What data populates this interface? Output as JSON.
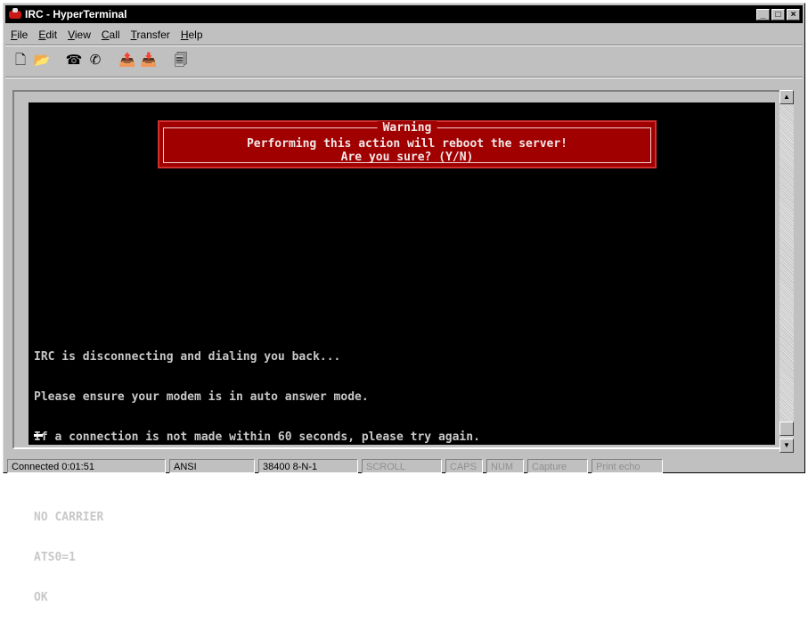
{
  "window": {
    "title": "IRC - HyperTerminal",
    "minimize_glyph": "_",
    "maximize_glyph": "□",
    "close_glyph": "×"
  },
  "menu": {
    "items": [
      {
        "label": "File"
      },
      {
        "label": "Edit"
      },
      {
        "label": "View"
      },
      {
        "label": "Call"
      },
      {
        "label": "Transfer"
      },
      {
        "label": "Help"
      }
    ]
  },
  "toolbar": {
    "buttons": [
      {
        "name": "new-icon",
        "glyph": "🗋"
      },
      {
        "name": "open-icon",
        "glyph": "📂"
      },
      {
        "name": "connect-icon",
        "glyph": "☎"
      },
      {
        "name": "disconnect-icon",
        "glyph": "✆"
      },
      {
        "name": "send-icon",
        "glyph": "📤"
      },
      {
        "name": "receive-icon",
        "glyph": "📥"
      },
      {
        "name": "properties-icon",
        "glyph": "🗐"
      }
    ]
  },
  "terminal": {
    "warning_title": "Warning",
    "warning_line1": "Performing this action will reboot the server!",
    "warning_line2": "Are you sure? (Y/N)",
    "lines": [
      "IRC is disconnecting and dialing you back...",
      "Please ensure your modem is in auto answer mode.",
      "If a connection is not made within 60 seconds, please try again.",
      "",
      "NO CARRIER",
      "ATS0=1",
      "OK"
    ]
  },
  "scrollbar": {
    "up_glyph": "▲",
    "down_glyph": "▼"
  },
  "status": {
    "connected": "Connected 0:01:51",
    "emulation": "ANSI",
    "settings": "38400 8-N-1",
    "scroll": "SCROLL",
    "caps": "CAPS",
    "num": "NUM",
    "capture": "Capture",
    "print_echo": "Print echo"
  },
  "colors": {
    "warning_bg": "#a00000",
    "terminal_bg": "#000000",
    "title_bar": "#000000"
  }
}
